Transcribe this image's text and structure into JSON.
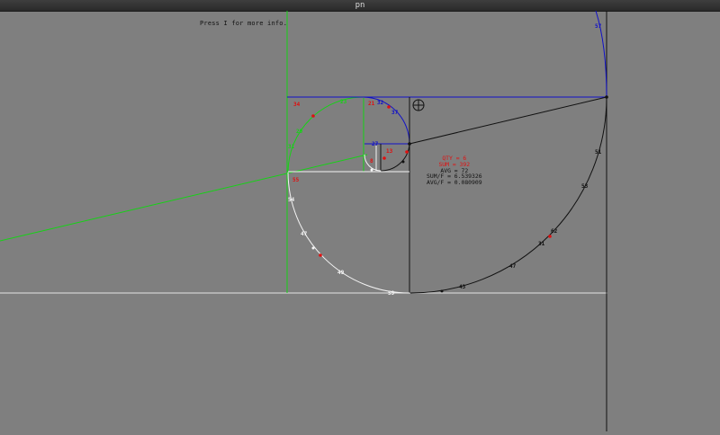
{
  "window": {
    "title": "pn"
  },
  "hint": "Press I for more info.",
  "stats": {
    "qty": "QTY = 6",
    "sum": "SUM = 392",
    "avg": "AVG = 72",
    "sum_f": "SUM/F = 6.539326",
    "avg_f": "AVG/F = 0.080909"
  },
  "colors": {
    "background": "#7f7f7f",
    "green": "#16d216",
    "blue": "#1010c8",
    "white": "#f4f4f4",
    "black": "#111111",
    "red": "#e01010"
  },
  "markers": {
    "red": [
      "34",
      "55",
      "21",
      "13",
      "8"
    ],
    "green": [
      "23",
      "29",
      "31"
    ],
    "blue": [
      "32",
      "37",
      "57",
      "27"
    ],
    "white": [
      "54",
      "47",
      "49",
      "59"
    ],
    "black": [
      "51",
      "53",
      "62",
      "47",
      "43",
      "31"
    ]
  },
  "cursor_icon": "crosshair-target-icon"
}
